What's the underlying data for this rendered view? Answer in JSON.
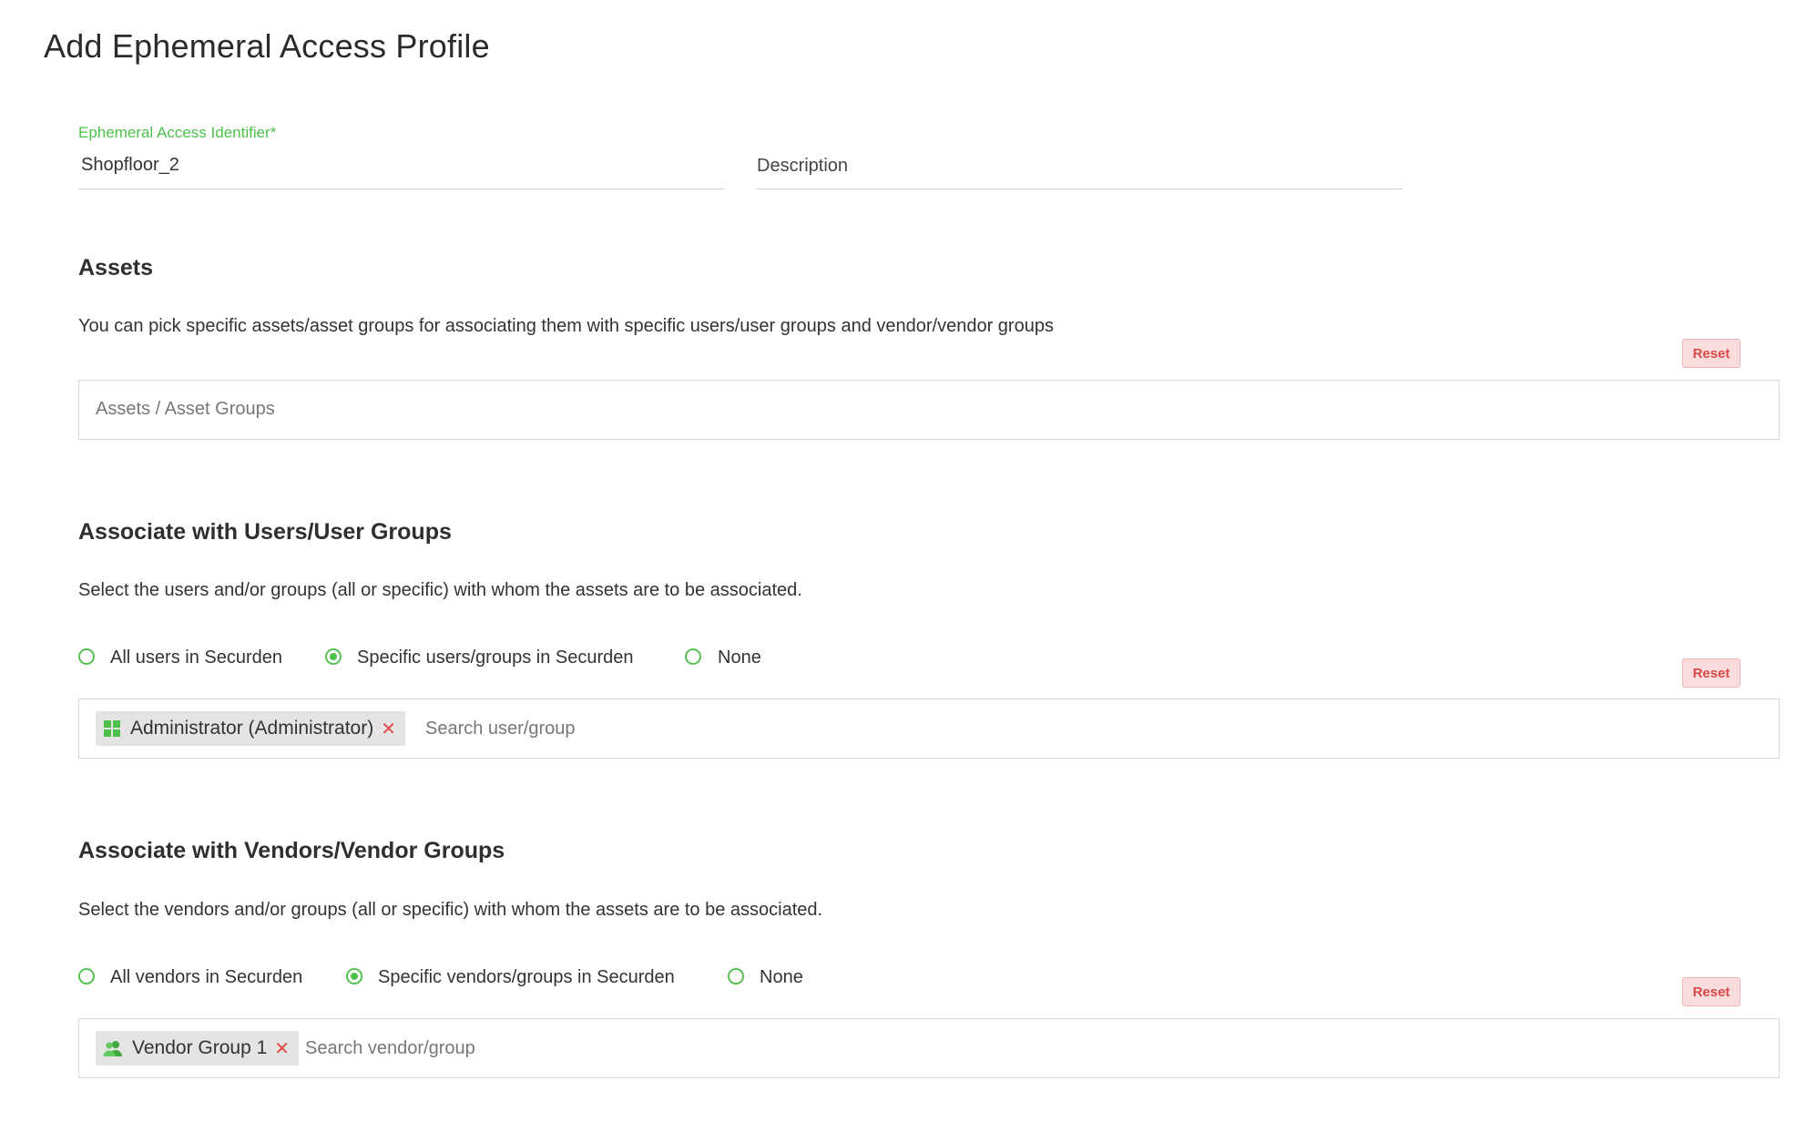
{
  "page": {
    "title": "Add Ephemeral Access Profile"
  },
  "identifier": {
    "label": "Ephemeral Access Identifier*",
    "value": "Shopfloor_2"
  },
  "description": {
    "placeholder": "Description"
  },
  "assets": {
    "title": "Assets",
    "desc": "You can pick specific assets/asset groups for associating them with specific users/user groups and vendor/vendor groups",
    "reset": "Reset",
    "placeholder": "Assets / Asset Groups"
  },
  "users": {
    "title": "Associate with Users/User Groups",
    "desc": "Select the users and/or groups (all or specific) with whom the assets are to be associated.",
    "options": [
      "All users in Securden",
      "Specific users/groups in Securden",
      "None"
    ],
    "selected": 1,
    "reset": "Reset",
    "chip": {
      "label": "Administrator (Administrator)",
      "icon": "windows-icon"
    },
    "search_placeholder": "Search user/group"
  },
  "vendors": {
    "title": "Associate with Vendors/Vendor Groups",
    "desc": "Select the vendors and/or groups (all or specific) with whom the assets are to be associated.",
    "options": [
      "All vendors in Securden",
      "Specific vendors/groups in Securden",
      "None"
    ],
    "selected": 1,
    "reset": "Reset",
    "chip": {
      "label": "Vendor Group 1",
      "icon": "user-group-icon"
    },
    "search_placeholder": "Search vendor/group"
  },
  "colors": {
    "accent": "#4cc14a",
    "danger": "#d84a4a",
    "reset_bg": "#fbdcdc"
  }
}
